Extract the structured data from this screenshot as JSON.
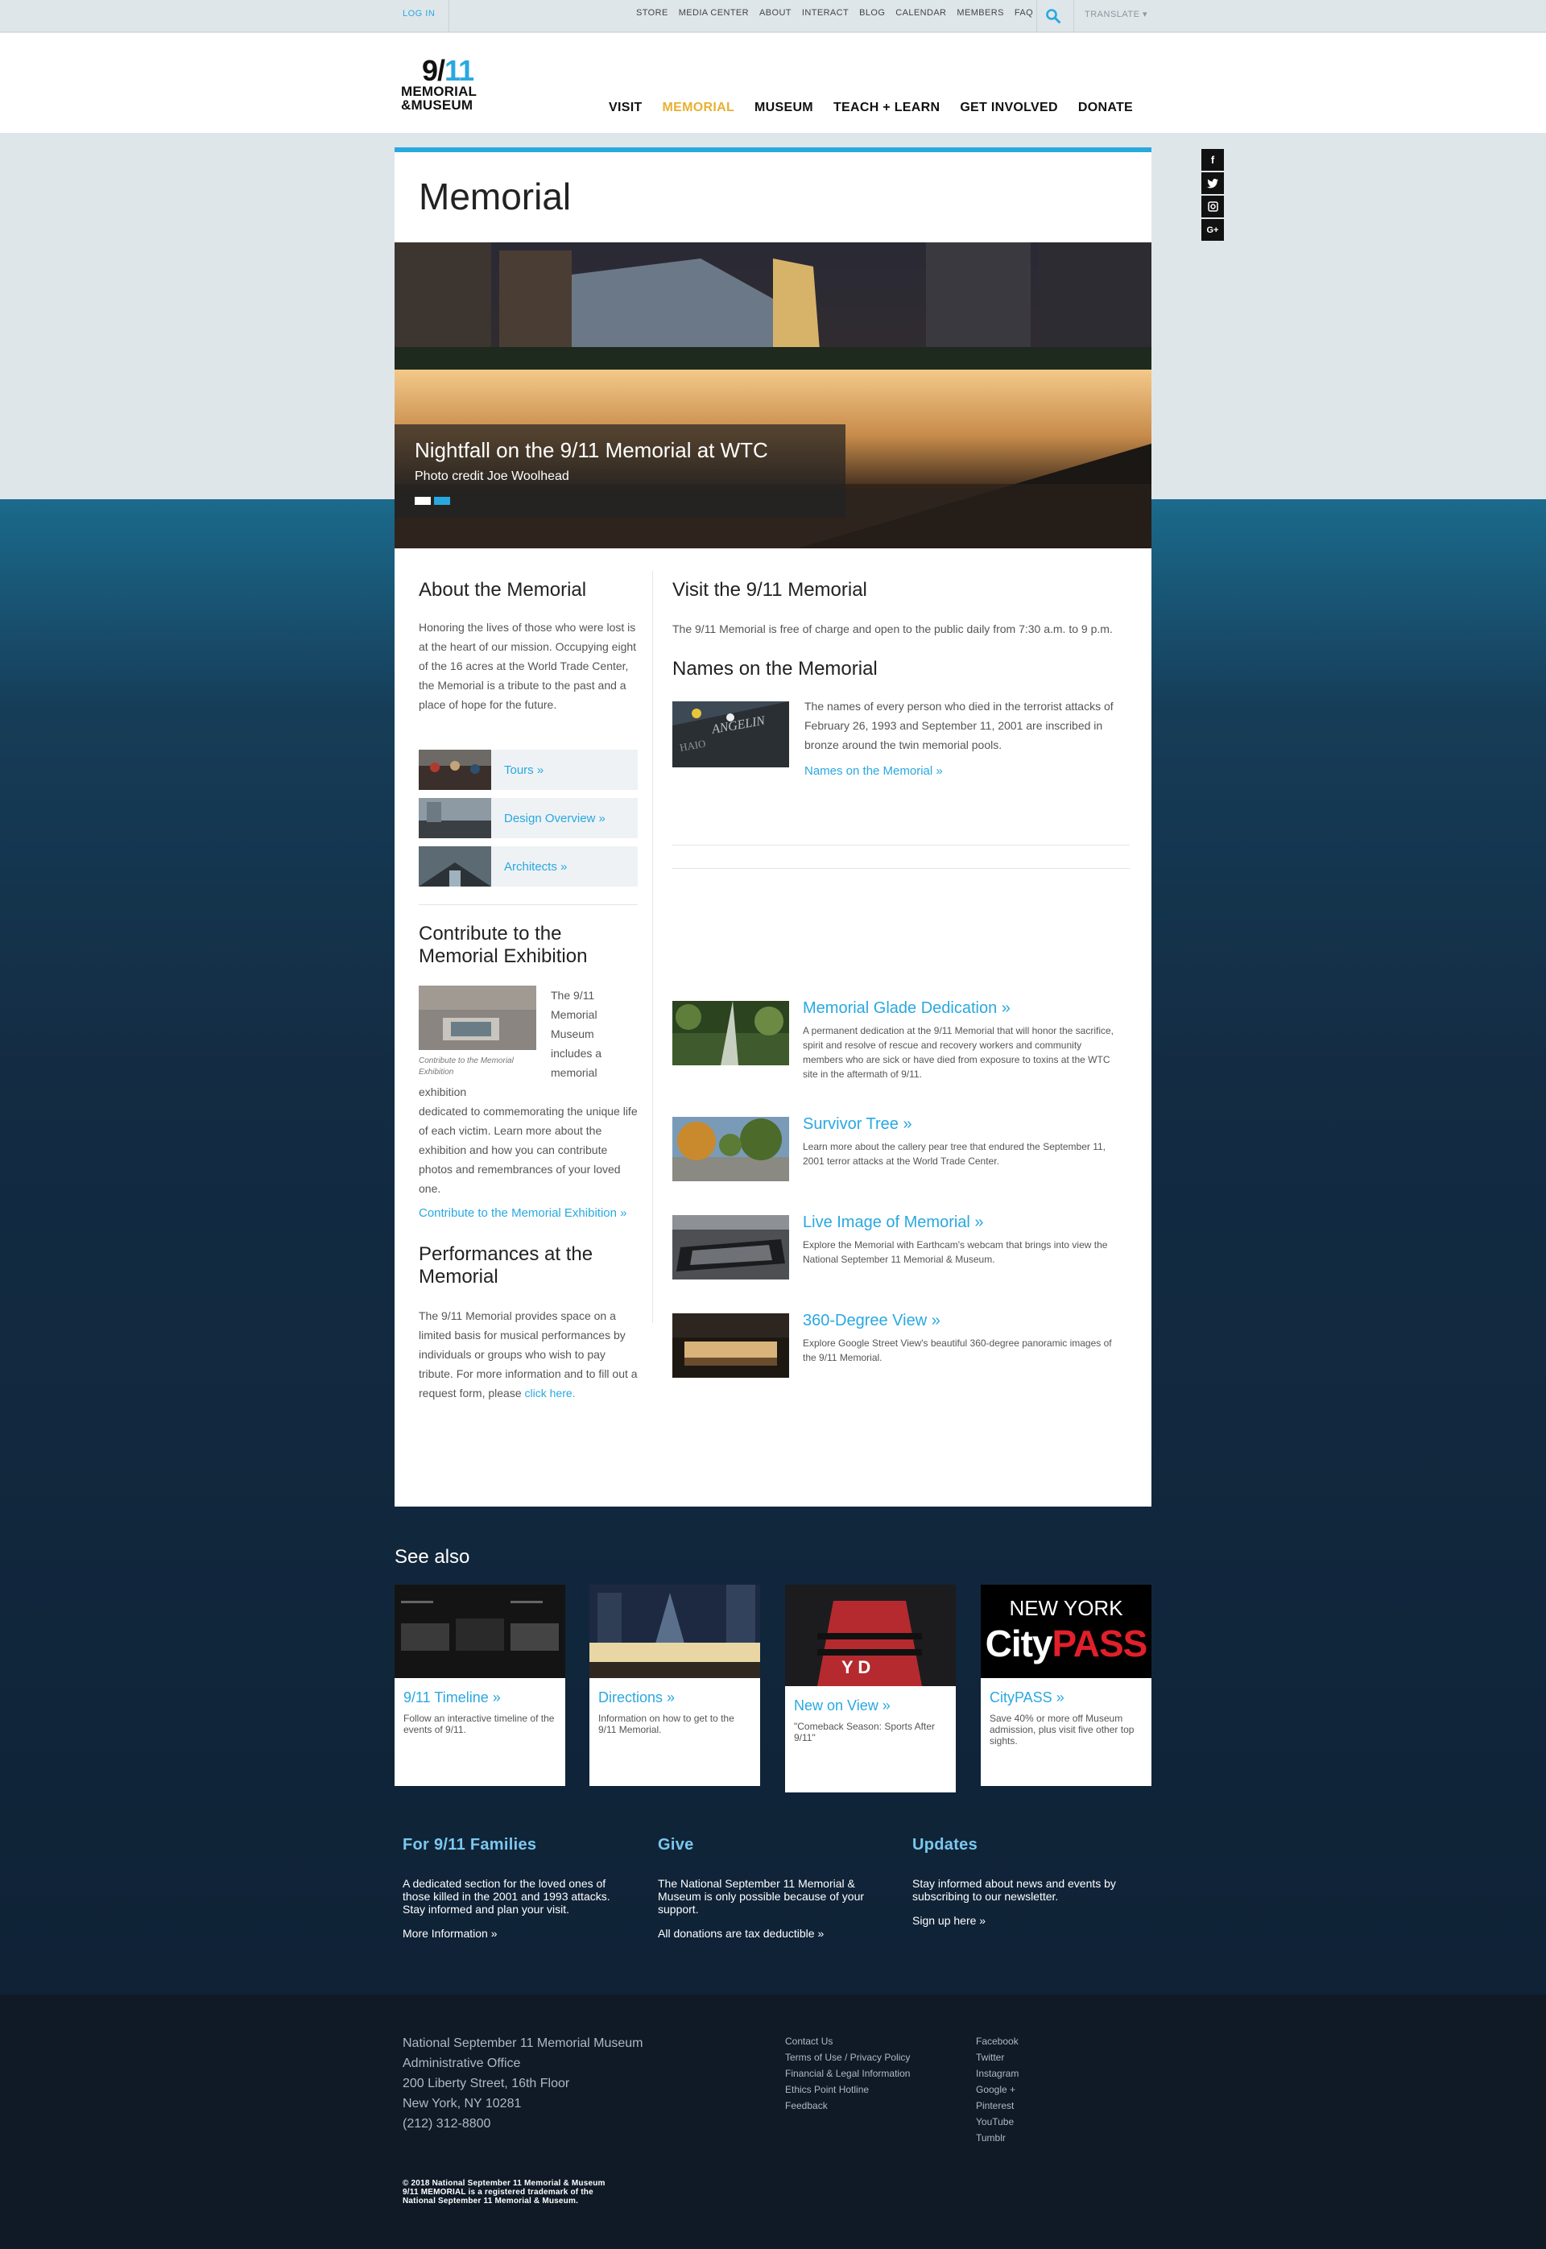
{
  "utility": {
    "login": "LOG IN",
    "links": [
      "STORE",
      "MEDIA CENTER",
      "ABOUT",
      "INTERACT",
      "BLOG",
      "CALENDAR",
      "MEMBERS",
      "FAQ"
    ],
    "translate": "TRANSLATE ▾"
  },
  "logo": {
    "line1_a": "9/",
    "line1_b": "11",
    "line2": "MEMORIAL",
    "line3": "&MUSEUM"
  },
  "nav": [
    "VISIT",
    "MEMORIAL",
    "MUSEUM",
    "TEACH + LEARN",
    "GET INVOLVED",
    "DONATE"
  ],
  "nav_active": "MEMORIAL",
  "social": [
    "f",
    "t",
    "ig",
    "G+"
  ],
  "page_title": "Memorial",
  "hero": {
    "title": "Nightfall on the 9/11 Memorial at WTC",
    "credit": "Photo credit Joe Woolhead"
  },
  "about": {
    "title": "About the Memorial",
    "text": "Honoring the lives of those who were lost is at the heart of our mission. Occupying eight of the 16 acres at the World Trade Center, the Memorial is a tribute to the past and a place of hope for the future.",
    "links": [
      "Tours  »",
      "Design Overview  »",
      "Architects  »"
    ]
  },
  "contribute": {
    "title": "Contribute to the Memorial Exhibition",
    "caption": "Contribute to the Memorial Exhibition",
    "text_wrap": "The 9/11 Memorial Museum includes a memorial exhibition",
    "text_rest": "dedicated to commemorating the unique life of each victim. Learn more about the exhibition and how you can contribute photos and remembrances of your loved one.",
    "link": "Contribute to the Memorial Exhibition »"
  },
  "performances": {
    "title": "Performances at the Memorial",
    "text": "The 9/11 Memorial provides space on a limited basis for musical performances by individuals or groups who wish to pay tribute. For more information and to fill out a request form, please",
    "link": "click here."
  },
  "visit": {
    "title": "Visit the 9/11 Memorial",
    "text": "The 9/11 Memorial is free of charge and open to the public daily from 7:30 a.m. to 9 p.m."
  },
  "names": {
    "title": "Names on the Memorial",
    "text": "The names of every person who died in the terrorist attacks of February 26, 1993 and September 11, 2001 are inscribed in bronze around the twin memorial pools.",
    "link": "Names on the Memorial »"
  },
  "features": [
    {
      "title": "Memorial Glade Dedication »",
      "desc": "A permanent dedication at the 9/11 Memorial that will honor the sacrifice, spirit and resolve of rescue and recovery workers and community members who are sick or have died from exposure to toxins at the WTC site in the aftermath of 9/11."
    },
    {
      "title": "Survivor Tree »",
      "desc": "Learn more about the callery pear tree that endured the September 11, 2001 terror attacks at the World Trade Center."
    },
    {
      "title": "Live Image of Memorial »",
      "desc": "Explore the Memorial with Earthcam's webcam that brings into view the National September 11 Memorial & Museum."
    },
    {
      "title": "360-Degree View »",
      "desc": "Explore Google Street View's beautiful 360-degree panoramic images of the 9/11 Memorial."
    }
  ],
  "see_also": {
    "title": "See also",
    "cards": [
      {
        "title": "9/11 Timeline »",
        "desc": "Follow an interactive timeline of the events of 9/11."
      },
      {
        "title": "Directions »",
        "desc": "Information on how to get to the 9/11 Memorial."
      },
      {
        "title": "New on View »",
        "desc": "\"Comeback Season: Sports After 9/11\""
      },
      {
        "title": "CityPASS »",
        "desc": "Save 40% or more off Museum admission, plus visit five other top sights."
      }
    ],
    "citypass_line1": "NEW YORK",
    "citypass_line2a": "City",
    "citypass_line2b": "PASS"
  },
  "bottom": [
    {
      "title": "For 9/11 Families",
      "desc": "A dedicated section for the loved ones of those killed in the 2001 and 1993 attacks. Stay informed and plan your visit.",
      "link": "More Information »"
    },
    {
      "title": "Give",
      "desc": "The National September 11 Memorial & Museum is only possible because of your support.",
      "link": "All donations are tax deductible »"
    },
    {
      "title": "Updates",
      "desc": "Stay informed about news and events by subscribing to our newsletter.",
      "link": "Sign up here »"
    }
  ],
  "footer": {
    "address": [
      "National September 11 Memorial Museum",
      "Administrative Office",
      "200 Liberty Street, 16th Floor",
      "New York, NY 10281",
      "(212) 312-8800"
    ],
    "links": [
      "Contact Us",
      "Terms of Use / Privacy Policy",
      "Financial & Legal Information",
      "Ethics Point Hotline",
      "Feedback"
    ],
    "social": [
      "Facebook",
      "Twitter",
      "Instagram",
      "Google +",
      "Pinterest",
      "YouTube",
      "Tumblr"
    ],
    "legal": [
      "© 2018 National September 11 Memorial & Museum",
      "9/11 MEMORIAL is a registered trademark of the",
      "National September 11 Memorial & Museum."
    ]
  },
  "colors": {
    "accent": "#29a8e0",
    "nav_active": "#e9b031",
    "footer_bg": "#0f1a26"
  }
}
